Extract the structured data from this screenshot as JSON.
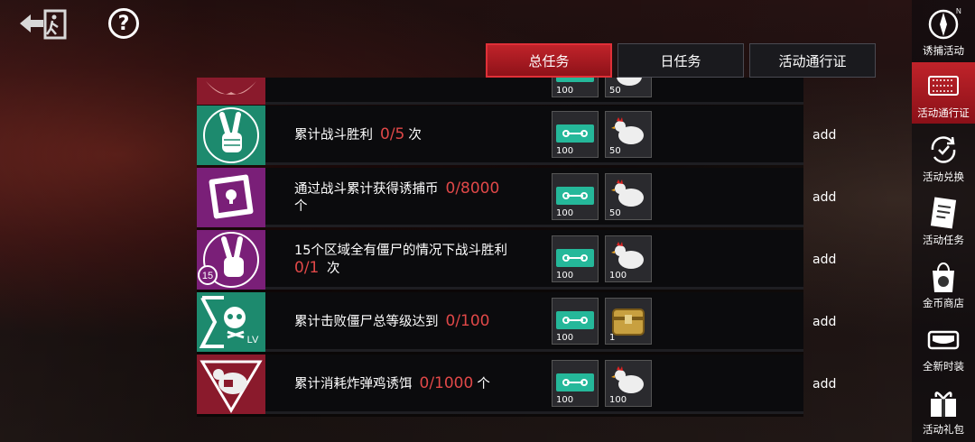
{
  "tabs": [
    {
      "label": "总任务",
      "active": true
    },
    {
      "label": "日任务",
      "active": false
    },
    {
      "label": "活动通行证",
      "active": false
    }
  ],
  "help_label": "?",
  "partial_row": {
    "rewards": [
      {
        "icon": "ticket-icon",
        "count": "100"
      },
      {
        "icon": "chicken-icon",
        "count": "50"
      }
    ]
  },
  "tasks": [
    {
      "icon": "victory-hand-icon",
      "text_before": "累计战斗胜利",
      "progress": "0/5",
      "text_after": "次",
      "rewards": [
        {
          "icon": "ticket-icon",
          "count": "100"
        },
        {
          "icon": "chicken-icon",
          "count": "50"
        }
      ],
      "action": "add"
    },
    {
      "icon": "lure-coin-icon",
      "text_before": "通过战斗累计获得诱捕币",
      "progress": "0/8000",
      "text_after": "个",
      "rewards": [
        {
          "icon": "ticket-icon",
          "count": "100"
        },
        {
          "icon": "chicken-icon",
          "count": "50"
        }
      ],
      "action": "add"
    },
    {
      "icon": "victory-hand-15-icon",
      "badge": "15",
      "text_before": "15个区域全有僵尸的情况下战斗胜利",
      "progress": "0/1",
      "text_after": "次",
      "rewards": [
        {
          "icon": "ticket-icon",
          "count": "100"
        },
        {
          "icon": "chicken-icon",
          "count": "100"
        }
      ],
      "action": "add"
    },
    {
      "icon": "skull-sum-level-icon",
      "text_before": "累计击败僵尸总等级达到",
      "progress": "0/100",
      "text_after": "",
      "rewards": [
        {
          "icon": "ticket-icon",
          "count": "100"
        },
        {
          "icon": "gold-chest-icon",
          "count": "1"
        }
      ],
      "action": "add"
    },
    {
      "icon": "chicken-bomb-icon",
      "text_before": "累计消耗炸弹鸡诱饵",
      "progress": "0/1000",
      "text_after": "个",
      "rewards": [
        {
          "icon": "ticket-icon",
          "count": "100"
        },
        {
          "icon": "chicken-icon",
          "count": "100"
        }
      ],
      "action": "add"
    }
  ],
  "sidebar": [
    {
      "label": "诱捕活动",
      "icon": "compass-icon",
      "active": false
    },
    {
      "label": "活动通行证",
      "icon": "pass-ticket-icon",
      "active": true
    },
    {
      "label": "活动兑换",
      "icon": "exchange-icon",
      "active": false
    },
    {
      "label": "活动任务",
      "icon": "task-list-icon",
      "active": false
    },
    {
      "label": "金币商店",
      "icon": "shopping-bag-icon",
      "active": false
    },
    {
      "label": "全新时装",
      "icon": "mask-icon",
      "active": false
    },
    {
      "label": "活动礼包",
      "icon": "gift-icon",
      "active": false
    }
  ],
  "colors": {
    "accent_red": "#c0232a",
    "progress_red": "#e04848",
    "icon_green": "#1d8a6e",
    "icon_purple": "#7a1f78",
    "icon_crimson": "#8a1a2c"
  }
}
